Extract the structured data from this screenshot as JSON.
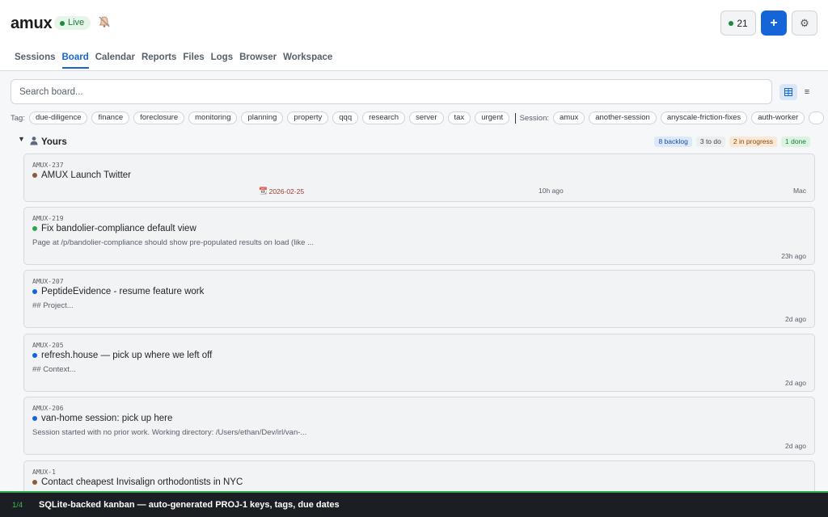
{
  "header": {
    "brand": "amux",
    "live_label": "Live",
    "session_count": "21",
    "add_label": "+"
  },
  "tabs": [
    {
      "label": "Sessions",
      "active": false
    },
    {
      "label": "Board",
      "active": true
    },
    {
      "label": "Calendar",
      "active": false
    },
    {
      "label": "Reports",
      "active": false
    },
    {
      "label": "Files",
      "active": false
    },
    {
      "label": "Logs",
      "active": false
    },
    {
      "label": "Browser",
      "active": false
    },
    {
      "label": "Workspace",
      "active": false
    }
  ],
  "search": {
    "placeholder": "Search board..."
  },
  "filters": {
    "tag_label": "Tag:",
    "tags": [
      "due-diligence",
      "finance",
      "foreclosure",
      "monitoring",
      "planning",
      "property",
      "qqq",
      "research",
      "server",
      "tax",
      "urgent"
    ],
    "session_label": "Session:",
    "sessions": [
      "amux",
      "another-session",
      "anyscale-friction-fixes",
      "auth-worker"
    ]
  },
  "section": {
    "title": "Yours",
    "counts": {
      "backlog": "8 backlog",
      "todo": "3 to do",
      "in_progress": "2 in progress",
      "done": "1 done"
    }
  },
  "cards": [
    {
      "key": "AMUX-237",
      "title": "AMUX Launch Twitter",
      "desc": "",
      "due": "2026-02-25",
      "time": "10h ago",
      "owner": "Mac",
      "status_color": "#8a5a3b"
    },
    {
      "key": "AMUX-219",
      "title": "Fix bandolier-compliance default view",
      "desc": "Page at /p/bandolier-compliance should show pre-populated results on load (like ...",
      "due": "",
      "time": "23h ago",
      "owner": "",
      "status_color": "#2da44e"
    },
    {
      "key": "AMUX-207",
      "title": "PeptideEvidence - resume feature work",
      "desc": "## Project...",
      "due": "",
      "time": "2d ago",
      "owner": "",
      "status_color": "#1565d8"
    },
    {
      "key": "AMUX-205",
      "title": "refresh.house — pick up where we left off",
      "desc": "## Context...",
      "due": "",
      "time": "2d ago",
      "owner": "",
      "status_color": "#1565d8"
    },
    {
      "key": "AMUX-206",
      "title": "van-home session: pick up here",
      "desc": "Session started with no prior work. Working directory: /Users/ethan/Dev/irl/van-...",
      "due": "",
      "time": "2d ago",
      "owner": "",
      "status_color": "#1565d8"
    },
    {
      "key": "AMUX-1",
      "title": "Contact cheapest Invisalign orthodontists in NYC",
      "desc": "",
      "due": "",
      "time": "",
      "owner": "",
      "status_color": "#8a5a3b"
    }
  ],
  "banner": {
    "step": "1/4",
    "text": "SQLite-backed kanban — auto-generated PROJ-1 keys, tags, due dates"
  },
  "colors": {
    "accent": "#1565d8",
    "live": "#1f883d"
  }
}
